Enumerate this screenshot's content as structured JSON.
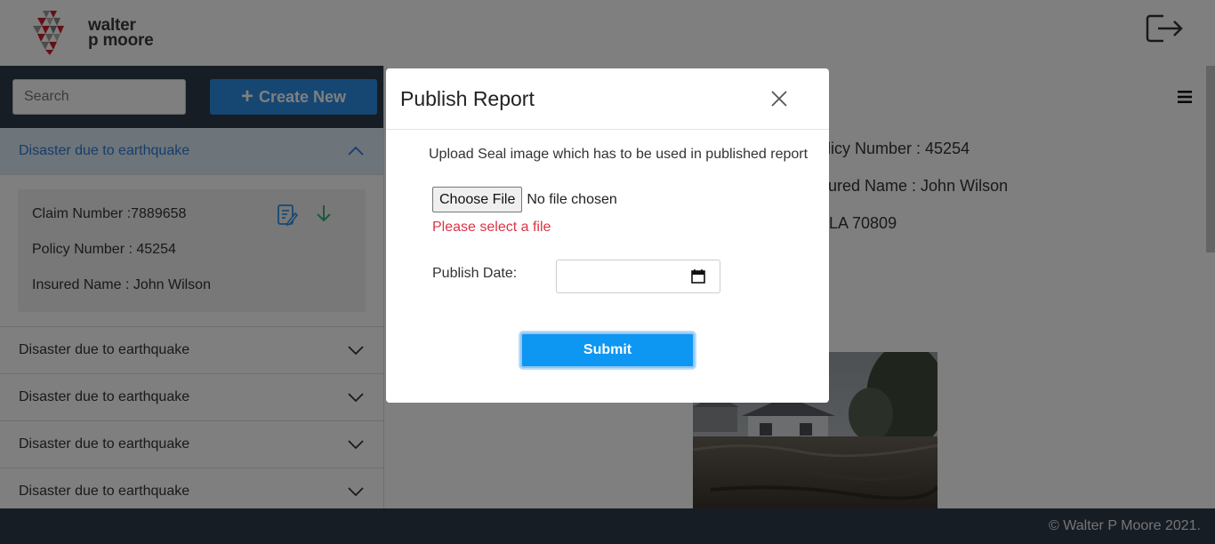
{
  "header": {
    "brand_line1": "walter",
    "brand_line2": "p moore"
  },
  "sidebar": {
    "search_placeholder": "Search",
    "create_label": "Create New",
    "items": [
      {
        "label": "Disaster due to earthquake",
        "expanded": true
      },
      {
        "label": "Disaster due to earthquake"
      },
      {
        "label": "Disaster due to earthquake"
      },
      {
        "label": "Disaster due to earthquake"
      },
      {
        "label": "Disaster due to earthquake"
      }
    ],
    "claim": {
      "claim_number": "Claim Number :7889658",
      "policy_number": "Policy Number : 45254",
      "insured_name": "Insured Name : John Wilson"
    }
  },
  "main": {
    "policy_line": "olicy Number : 45254",
    "insured_line": "sured Name : John Wilson",
    "address_line": "LA 70809"
  },
  "modal": {
    "title": "Publish Report",
    "upload_text": "Upload Seal image which has to be used in published report",
    "choose_file_label": "Choose File",
    "no_file_text": "No file chosen",
    "error_text": "Please select a file",
    "publish_date_label": "Publish Date:",
    "submit_label": "Submit"
  },
  "footer": {
    "copyright": "© Walter P Moore 2021."
  },
  "colors": {
    "nav_dark": "#2e3b49",
    "primary_blue": "#2c8ee6",
    "submit_blue": "#0d96f2",
    "error_red": "#dc3545",
    "logo_red": "#c8202f"
  }
}
